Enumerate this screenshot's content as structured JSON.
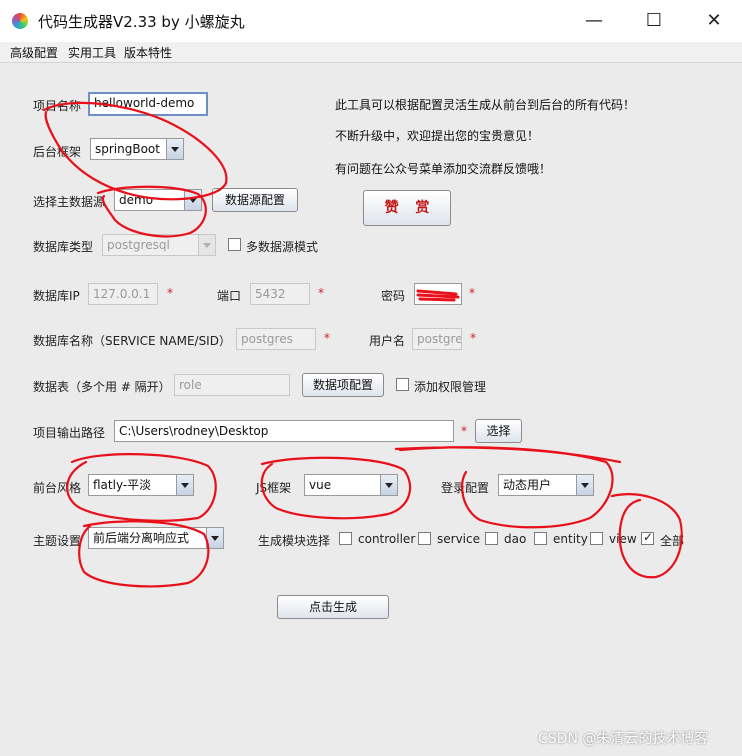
{
  "window": {
    "title": "代码生成器V2.33 by 小螺旋丸",
    "minimize_glyph": "—",
    "maximize_glyph": "☐",
    "close_glyph": "✕"
  },
  "menu": [
    "高级配置",
    "实用工具",
    "版本特性"
  ],
  "form": {
    "project_name": {
      "label": "项目名称",
      "value": "helloworld-demo"
    },
    "backend": {
      "label": "后台框架",
      "value": "springBoot"
    },
    "main_datasource": {
      "label": "选择主数据源",
      "value": "demo",
      "config_button": "数据源配置"
    },
    "db_type": {
      "label": "数据库类型",
      "value": "postgresql",
      "multi_label": "多数据源模式"
    },
    "db_ip": {
      "label": "数据库IP",
      "value": "127.0.0.1"
    },
    "port": {
      "label": "端口",
      "value": "5432"
    },
    "password": {
      "label": "密码"
    },
    "db_name": {
      "label": "数据库名称（SERVICE NAME/SID）",
      "value": "postgres"
    },
    "username": {
      "label": "用户名",
      "value": "postgres"
    },
    "tables": {
      "label": "数据表（多个用 # 隔开）",
      "value": "role",
      "config_button": "数据项配置",
      "perm_label": "添加权限管理"
    },
    "output_path": {
      "label": "项目输出路径",
      "value": "C:\\Users\\rodney\\Desktop",
      "choose_button": "选择"
    },
    "frontend_style": {
      "label": "前台风格",
      "value": "flatly-平淡"
    },
    "js_framework": {
      "label": "JS框架",
      "value": "vue"
    },
    "login_config": {
      "label": "登录配置",
      "value": "动态用户"
    },
    "theme": {
      "label": "主题设置",
      "value": "前后端分离响应式"
    },
    "modules": {
      "label": "生成模块选择",
      "items": [
        {
          "name": "controller",
          "checked": false
        },
        {
          "name": "service",
          "checked": false
        },
        {
          "name": "dao",
          "checked": false
        },
        {
          "name": "entity",
          "checked": false
        },
        {
          "name": "view",
          "checked": false
        },
        {
          "name": "全部",
          "checked": true
        }
      ]
    },
    "required_mark": "*"
  },
  "info_lines": [
    "此工具可以根据配置灵活生成从前台到后台的所有代码！",
    "不断升级中，欢迎提出您的宝贵意见！",
    "有问题在公众号菜单添加交流群反馈哦！"
  ],
  "reward_button": "赞 赏",
  "generate_button": "点击生成",
  "watermark": "CSDN @朱清云的技术博客",
  "colors": {
    "annotation_red": "#e8101a"
  }
}
